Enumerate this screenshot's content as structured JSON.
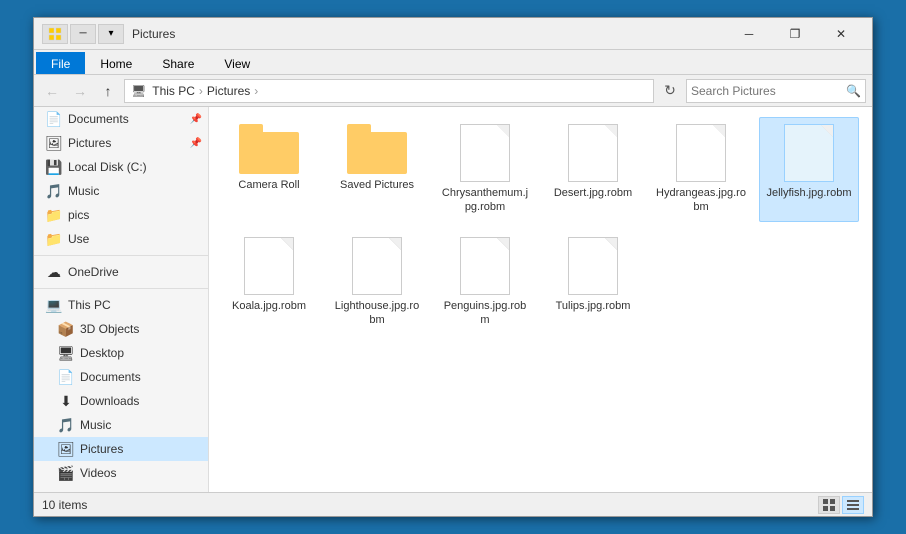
{
  "window": {
    "title": "Pictures",
    "icon": "📁"
  },
  "title_bar_buttons": [
    "─",
    "❐",
    "—"
  ],
  "ribbon": {
    "tabs": [
      "File",
      "Home",
      "Share",
      "View"
    ]
  },
  "address_bar": {
    "path": [
      "This PC",
      "Pictures"
    ],
    "search_placeholder": "Search Pictures"
  },
  "sidebar": {
    "quick_access": [
      {
        "label": "Documents",
        "icon": "📄",
        "pinned": true
      },
      {
        "label": "Pictures",
        "icon": "🖼",
        "pinned": true
      }
    ],
    "drives": [
      {
        "label": "Local Disk (C:)",
        "icon": "💾"
      }
    ],
    "media": [
      {
        "label": "Music",
        "icon": "🎵"
      },
      {
        "label": "pics",
        "icon": "📁"
      },
      {
        "label": "Use",
        "icon": "📁"
      }
    ],
    "onedrive": {
      "label": "OneDrive",
      "icon": "☁"
    },
    "this_pc": {
      "label": "This PC",
      "icon": "💻",
      "items": [
        {
          "label": "3D Objects",
          "icon": "📦"
        },
        {
          "label": "Desktop",
          "icon": "🖥"
        },
        {
          "label": "Documents",
          "icon": "📄"
        },
        {
          "label": "Downloads",
          "icon": "⬇"
        },
        {
          "label": "Music",
          "icon": "🎵"
        },
        {
          "label": "Pictures",
          "icon": "🖼"
        },
        {
          "label": "Videos",
          "icon": "🎬"
        }
      ]
    }
  },
  "files": [
    {
      "name": "Camera Roll",
      "type": "folder"
    },
    {
      "name": "Saved Pictures",
      "type": "folder"
    },
    {
      "name": "Chrysanthemum.jpg.robm",
      "type": "file"
    },
    {
      "name": "Desert.jpg.robm",
      "type": "file"
    },
    {
      "name": "Hydrangeas.jpg.robm",
      "type": "file"
    },
    {
      "name": "Jellyfish.jpg.robm",
      "type": "file",
      "selected": true
    },
    {
      "name": "Koala.jpg.robm",
      "type": "file"
    },
    {
      "name": "Lighthouse.jpg.robm",
      "type": "file"
    },
    {
      "name": "Penguins.jpg.robm",
      "type": "file"
    },
    {
      "name": "Tulips.jpg.robm",
      "type": "file"
    }
  ],
  "status_bar": {
    "count": "10 items"
  },
  "nav": {
    "back": "←",
    "forward": "→",
    "up": "↑"
  }
}
